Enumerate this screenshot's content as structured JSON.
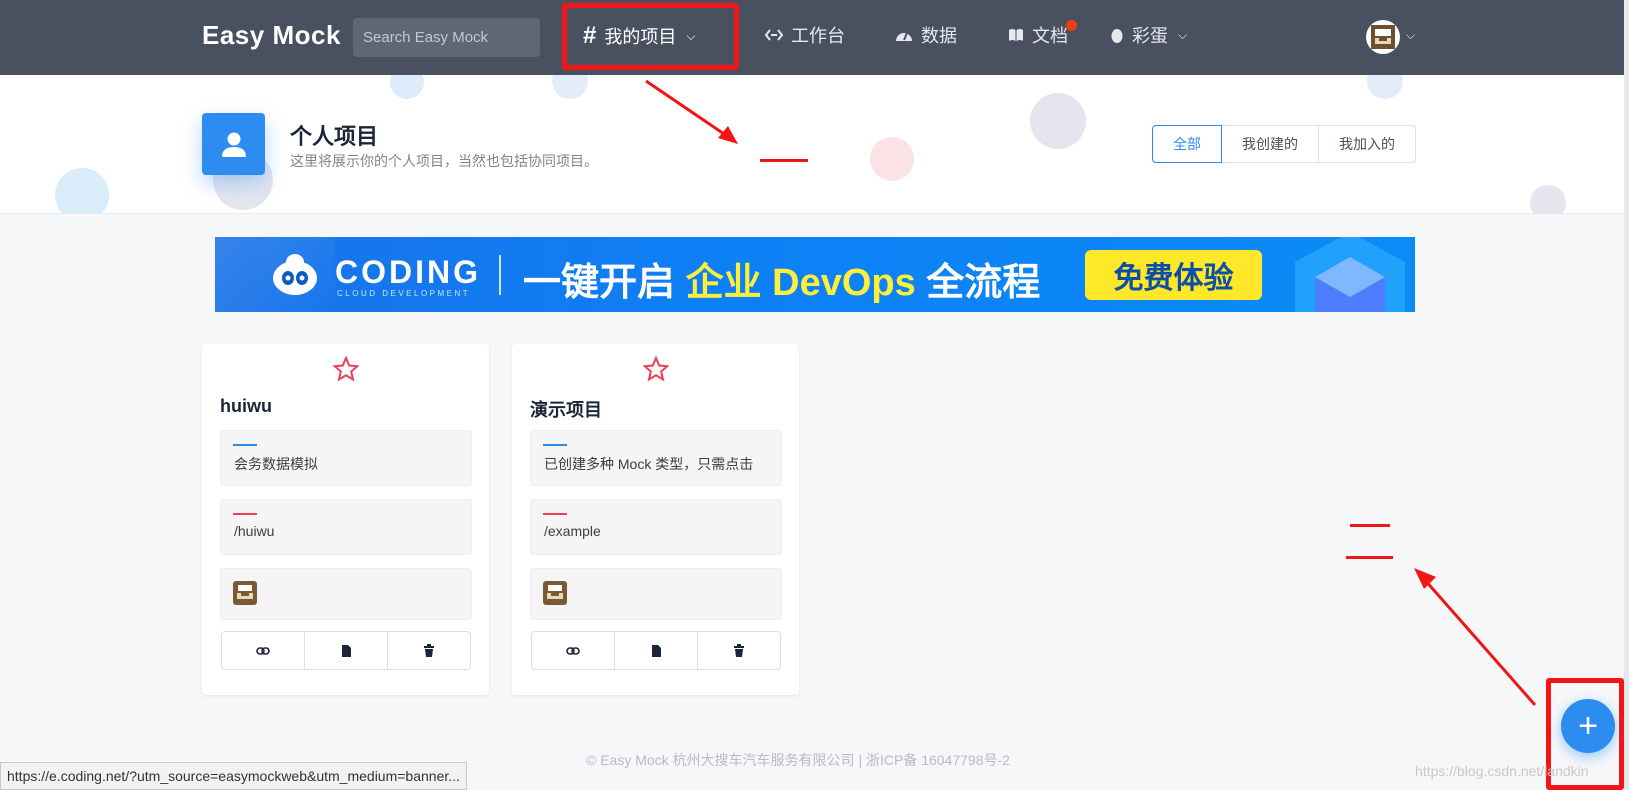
{
  "navbar": {
    "brand": "Easy Mock",
    "search_placeholder": "Search Easy Mock",
    "items": [
      {
        "icon": "hash-icon",
        "label": "我的项目",
        "active": true,
        "dropdown": true
      },
      {
        "icon": "code-arrows-icon",
        "label": "工作台"
      },
      {
        "icon": "dashboard-icon",
        "label": "数据"
      },
      {
        "icon": "book-icon",
        "label": "文档",
        "badge": true
      },
      {
        "icon": "egg-icon",
        "label": "彩蛋",
        "dropdown": true
      }
    ],
    "avatar_icon": "user-avatar-icon"
  },
  "header": {
    "icon": "user-icon",
    "title": "个人项目",
    "subtitle": "这里将展示你的个人项目，当然也包括协同项目。",
    "filters": [
      "全部",
      "我创建的",
      "我加入的"
    ],
    "active_filter": "全部"
  },
  "banner": {
    "brand": "CODING",
    "brand_sub": "CLOUD DEVELOPMENT",
    "slogan_part1": "一键开启 ",
    "slogan_highlight": "企业 DevOps",
    "slogan_part2": " 全流程",
    "cta": "免费体验"
  },
  "projects": [
    {
      "name": "huiwu",
      "description": "会务数据模拟",
      "url": "/huiwu",
      "starred": false
    },
    {
      "name": "演示项目",
      "description": "已创建多种 Mock 类型，只需点击",
      "url": "/example",
      "starred": false
    }
  ],
  "annotations": {
    "mark_one": "一",
    "mark_two": "二"
  },
  "fab_label": "+",
  "footer": "© Easy Mock 杭州大搜车汽车服务有限公司 | 浙ICP备 16047798号-2",
  "watermark": "https://blog.csdn.net/landkin",
  "status_url": "https://e.coding.net/?utm_source=easymockweb&utm_medium=banner...",
  "colors": {
    "primary": "#2d8cf0",
    "nav_bg": "#495060",
    "accent_red": "#f21515",
    "star": "#ed3f56"
  }
}
